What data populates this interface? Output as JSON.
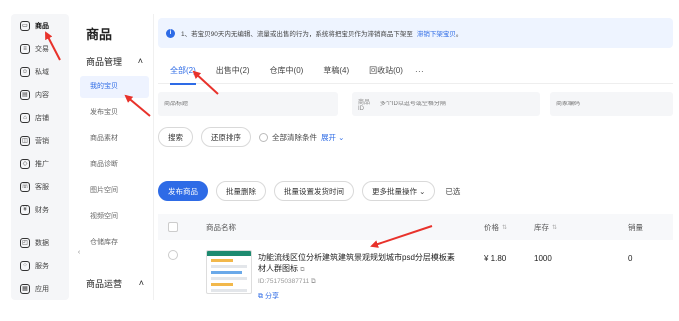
{
  "rail": {
    "items": [
      {
        "label": "商品",
        "icon": "product-icon",
        "glyph": "▭",
        "active": true
      },
      {
        "label": "交易",
        "icon": "trade-icon",
        "glyph": "≡"
      },
      {
        "label": "私域",
        "icon": "private-domain-icon",
        "glyph": "☺"
      },
      {
        "label": "内容",
        "icon": "content-icon",
        "glyph": "▤"
      },
      {
        "label": "店铺",
        "icon": "store-icon",
        "glyph": "⌂"
      },
      {
        "label": "营销",
        "icon": "marketing-icon",
        "glyph": "◫"
      },
      {
        "label": "推广",
        "icon": "promotion-icon",
        "glyph": "◇"
      },
      {
        "label": "客服",
        "icon": "customer-service-icon",
        "glyph": "☏"
      },
      {
        "label": "财务",
        "icon": "finance-icon",
        "glyph": "¥"
      },
      {
        "label": "数据",
        "icon": "data-icon",
        "glyph": "◰"
      },
      {
        "label": "服务",
        "icon": "service-icon",
        "glyph": "⁘"
      },
      {
        "label": "应用",
        "icon": "app-icon",
        "glyph": "▦"
      }
    ],
    "collapse_glyph": "‹"
  },
  "submenu": {
    "title": "商品",
    "group_label": "商品管理",
    "group_toggle": "˄",
    "items": [
      {
        "label": "我的宝贝",
        "active": true
      },
      {
        "label": "发布宝贝"
      },
      {
        "label": "商品素材"
      },
      {
        "label": "商品诊断"
      },
      {
        "label": "图片空间"
      },
      {
        "label": "视频空间"
      },
      {
        "label": "仓储库存"
      }
    ],
    "group2_label": "商品运营",
    "group2_toggle": "˄"
  },
  "notice": {
    "info_glyph": "i",
    "text": "1、若宝贝90天内无编辑、流量或出售的行为，系统将把宝贝作为滞销商品下架至",
    "link": "滞销下架宝贝",
    "tail": "。"
  },
  "tabs": [
    {
      "label": "全部(2)",
      "active": true
    },
    {
      "label": "出售中(2)"
    },
    {
      "label": "仓库中(0)"
    },
    {
      "label": "草稿(4)"
    },
    {
      "label": "回收站(0)"
    }
  ],
  "tabs_more": "···",
  "filters": [
    {
      "label": "",
      "placeholder": "商品标题"
    },
    {
      "label": "商品ID",
      "placeholder": "多个ID以逗号或空格分隔"
    },
    {
      "label": "",
      "placeholder": "商家编码"
    }
  ],
  "actions": {
    "search": "搜索",
    "reset": "还原排序",
    "clear_conditions": "全部清除条件",
    "expand": "展开"
  },
  "bulk": {
    "publish": "发布商品",
    "batch_delete": "批量删除",
    "batch_schedule": "批量设置发货时间",
    "more": "更多批量操作",
    "selected": "已选"
  },
  "table": {
    "columns": {
      "name": "商品名称",
      "price": "价格",
      "stock": "库存",
      "sales": "销量"
    },
    "rows": [
      {
        "name": "功能流线区位分析建筑建筑景观规划城市psd分层模板素材人群图标",
        "id": "ID:751750387711",
        "share": "分享",
        "price": "¥ 1.80",
        "stock": "1000",
        "sales": "0"
      }
    ]
  },
  "colors": {
    "accent": "#2e6be6",
    "arrow": "#e8322b"
  }
}
